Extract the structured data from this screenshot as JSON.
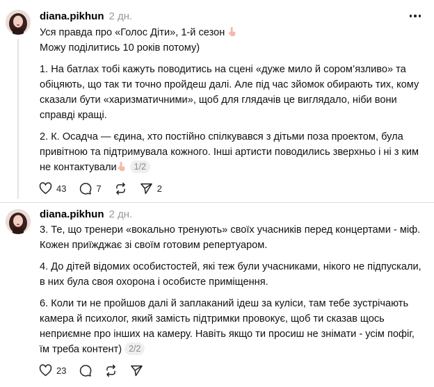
{
  "posts": [
    {
      "username": "diana.pikhun",
      "time": "2 дн.",
      "lines": [
        "Уся правда про «Голос Діти», 1-й сезон",
        "Можу поділитись 10 років потому)"
      ],
      "paragraphs": [
        "1. На батлах тобі кажуть поводитись на сцені «дуже мило й сором’язливо» та обіцяють, що так ти точно пройдеш далі. Але під час зйомок обирають тих, кому сказали бути «харизматичними», щоб для глядачів це виглядало, ніби вони справді кращі.",
        "2. К. Осадча — єдина, хто постійно спілкувався з дітьми поза проектом, була привітною та підтримувала кожного. Інші артисти поводились зверхньо і ні з ким не контактували"
      ],
      "pager": "1/2",
      "likes": "43",
      "comments": "7",
      "shares": "2"
    },
    {
      "username": "diana.pikhun",
      "time": "2 дн.",
      "paragraphs": [
        "3. Те, що тренери «вокально тренують» своїх учасників перед концертами - міф. Кожен приїжджає зі своїм готовим репертуаром.",
        "4. До дітей відомих особистостей, які теж були учасниками, нікого не підпускали, в них була своя охорона і особисте приміщення.",
        "6. Коли ти не пройшов далі й заплаканий ідеш за куліси, там тебе зустрічають камера й психолог, який замість підтримки провокує, щоб ти сказав щось неприємне про інших на камеру. Навіть якщо ти просиш не знімати - усім пофіг, їм треба контент)"
      ],
      "pager": "2/2",
      "likes": "23"
    }
  ],
  "colors": {
    "muted": "#9a9a9a",
    "pager_bg": "#efefef",
    "divider": "#dcdcdc"
  }
}
